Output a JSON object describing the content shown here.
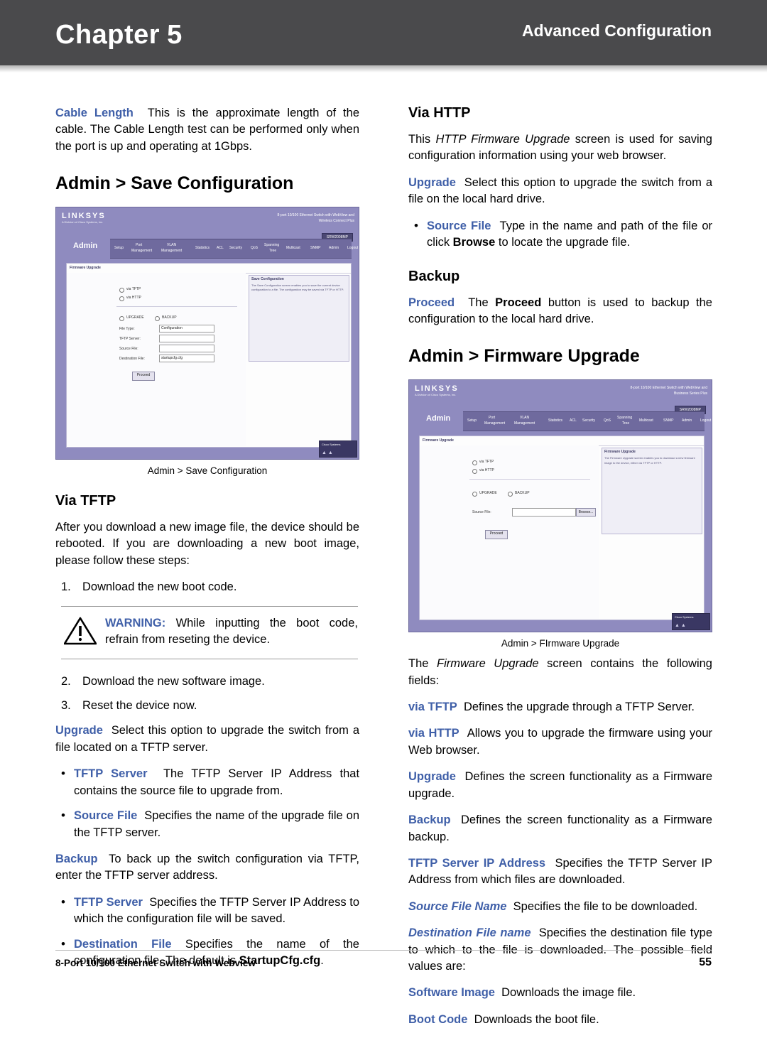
{
  "header": {
    "chapter_word": "Chapter",
    "chapter_number": "5",
    "right_title": "Advanced Configuration"
  },
  "footer": {
    "left": "8-Port 10/100 Ethernet Switch with Webview",
    "page_number": "55"
  },
  "left_column": {
    "cable_length": {
      "term": "Cable Length",
      "text": "This is the approximate length of the cable. The Cable Length test can be performed only when the port is up and operating at 1Gbps."
    },
    "heading_save_config": "Admin > Save Configuration",
    "figure1_caption": "Admin > Save Configuration",
    "heading_via_tftp": "Via TFTP",
    "tftp_intro": "After you download a new image file, the device should be rebooted. If you are downloading a new boot image, please follow these steps:",
    "steps": [
      {
        "n": "1.",
        "text": "Download the new boot code."
      },
      {
        "n": "2.",
        "text": "Download the new software image."
      },
      {
        "n": "3.",
        "text": "Reset the device now."
      }
    ],
    "warning": {
      "label": "WARNING:",
      "text": "While inputting the boot code, refrain from reseting the device.",
      "icon": "warning-triangle-icon"
    },
    "upgrade": {
      "term": "Upgrade",
      "text": "Select this option to upgrade the switch from a file located on a TFTP server."
    },
    "bullets1": [
      {
        "term": "TFTP Server",
        "text": "The TFTP Server IP Address that contains the source file to upgrade from."
      },
      {
        "term": "Source File",
        "text": "Specifies the name of the upgrade file on the TFTP server."
      }
    ],
    "backup": {
      "term": "Backup",
      "text": "To back up the switch configuration via TFTP, enter the TFTP server address."
    },
    "bullets2": [
      {
        "term": "TFTP Server",
        "text": "Specifies the TFTP Server IP Address to which the configuration file will be saved."
      },
      {
        "term": "Destination File",
        "text": "Specifies the name of the configuration file. The default is ",
        "bold_tail": "StartupCfg.cfg",
        "tail_end": "."
      }
    ]
  },
  "right_column": {
    "heading_via_http": "Via HTTP",
    "http_intro_pre": "This ",
    "http_intro_italic": "HTTP Firmware Upgrade",
    "http_intro_post": " screen is used for saving configuration information using your web browser.",
    "upgrade": {
      "term": "Upgrade",
      "text": "Select this option to upgrade the switch from a file on the local hard drive."
    },
    "bullet_source_file": {
      "term": "Source File",
      "text_pre": "Type in the name and path of the file or click ",
      "bold": "Browse",
      "text_post": " to locate the upgrade file."
    },
    "heading_backup": "Backup",
    "proceed": {
      "term": "Proceed",
      "text_pre": "The ",
      "bold": "Proceed",
      "text_post": " button is used to backup the configuration to the local hard drive."
    },
    "heading_firmware_upgrade": "Admin > Firmware Upgrade",
    "figure2_caption": "Admin > FIrmware Upgrade",
    "fields_intro_pre": "The ",
    "fields_intro_italic": "Firmware Upgrade",
    "fields_intro_post": " screen contains the following fields:",
    "defs": [
      {
        "term": "via TFTP",
        "text": "Defines the upgrade through a TFTP Server."
      },
      {
        "term": "via HTTP",
        "text": "Allows you to upgrade the firmware using your Web browser."
      },
      {
        "term": "Upgrade",
        "text": "Defines the screen functionality as a Firmware upgrade."
      },
      {
        "term": "Backup",
        "text": "Defines the screen functionality as a Firmware backup."
      },
      {
        "term": "TFTP Server IP Address",
        "text": "Specifies the TFTP Server IP Address from which files are downloaded."
      },
      {
        "term": "Source File Name",
        "text": "Specifies the file to be downloaded."
      },
      {
        "term": "Destination File name",
        "text": "Specifies the destination file type to which to the file is downloaded. The possible field values are:"
      },
      {
        "term": "Software Image",
        "text": "Downloads the image file."
      },
      {
        "term": "Boot Code",
        "text": "Downloads the boot file."
      }
    ]
  },
  "screenshot1": {
    "name": "admin-save-configuration-screenshot",
    "logo": "LINKSYS",
    "logo_sub": "A Division of Cisco Systems, Inc.",
    "top_right_line1": "8-port 10/100 Ethernet Switch with WebView and",
    "top_right_line2": "Wireless Connect Plus",
    "model": "SRW2008MP",
    "admin_tab": "Admin",
    "nav_items": [
      "Setup",
      "Port\nManagement",
      "VLAN\nManagement",
      "Statistics",
      "ACL",
      "Security",
      "QoS",
      "Spanning\nTree",
      "Multicast",
      "SNMP",
      "Admin",
      "Logout"
    ],
    "panel_title": "Firmware Upgrade",
    "section_title": "Save Configuration",
    "radio1": "via TFTP",
    "radio2": "via HTTP",
    "opt1": "UPGRADE",
    "opt2": "BACKUP",
    "labels": [
      "File Type:",
      "TFTP Server:",
      "Source File:",
      "Destination File:"
    ],
    "file_type_value": "Configuration",
    "dest_value": "startupcfg.cfg",
    "button": "Proceed",
    "help_title": "Save Configuration",
    "help_body": "The Save Configuration screen enables you to save the current device configuration to a file. The configuration may be saved via TFTP or HTTP.",
    "corner_title": "Cisco Systems",
    "corner_arrows": "▲▲"
  },
  "screenshot2": {
    "name": "admin-firmware-upgrade-screenshot",
    "logo": "LINKSYS",
    "logo_sub": "A Division of Cisco Systems, Inc.",
    "top_right_line1": "8-port 10/100 Ethernet Switch with WebView and",
    "top_right_line2": "Business Series Plus",
    "model": "SRW2008MP",
    "admin_tab": "Admin",
    "nav_items": [
      "Setup",
      "Port\nManagement",
      "VLAN\nManagement",
      "Statistics",
      "ACL",
      "Security",
      "QoS",
      "Spanning\nTree",
      "Multicast",
      "SNMP",
      "Admin",
      "Logout"
    ],
    "panel_title": "Firmware Upgrade",
    "section_title": "Firmware Upgrade",
    "radio1": "via TFTP",
    "radio2": "via HTTP",
    "opt1": "UPGRADE",
    "opt2": "BACKUP",
    "label_source": "Source File:",
    "browse_button": "Browse...",
    "button": "Proceed",
    "help_title": "Firmware Upgrade",
    "help_body": "The Firmware Upgrade screen enables you to download a new firmware image to the device, either via TFTP or HTTP.",
    "corner_title": "Cisco Systems",
    "corner_arrows": "▲▲"
  }
}
